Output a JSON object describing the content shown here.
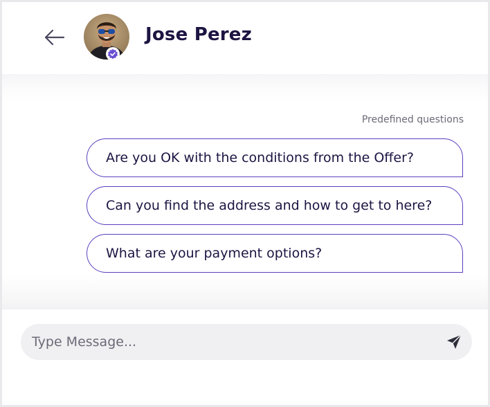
{
  "header": {
    "back_icon": "arrow-left-icon",
    "avatar_icon": "user-avatar",
    "verified_icon": "verified-badge-icon",
    "name": "Jose Perez"
  },
  "chat": {
    "predefined_label": "Predefined questions",
    "questions": [
      "Are you OK with the conditions from the Offer?",
      "Can you find the address and how to get to here?",
      "What are your payment options?"
    ]
  },
  "composer": {
    "placeholder": "Type Message...",
    "value": "",
    "send_icon": "send-icon"
  },
  "colors": {
    "accent": "#5b3fbf",
    "text": "#1d1442",
    "muted": "#6b6a78",
    "input_bg": "#f0f0f2"
  }
}
